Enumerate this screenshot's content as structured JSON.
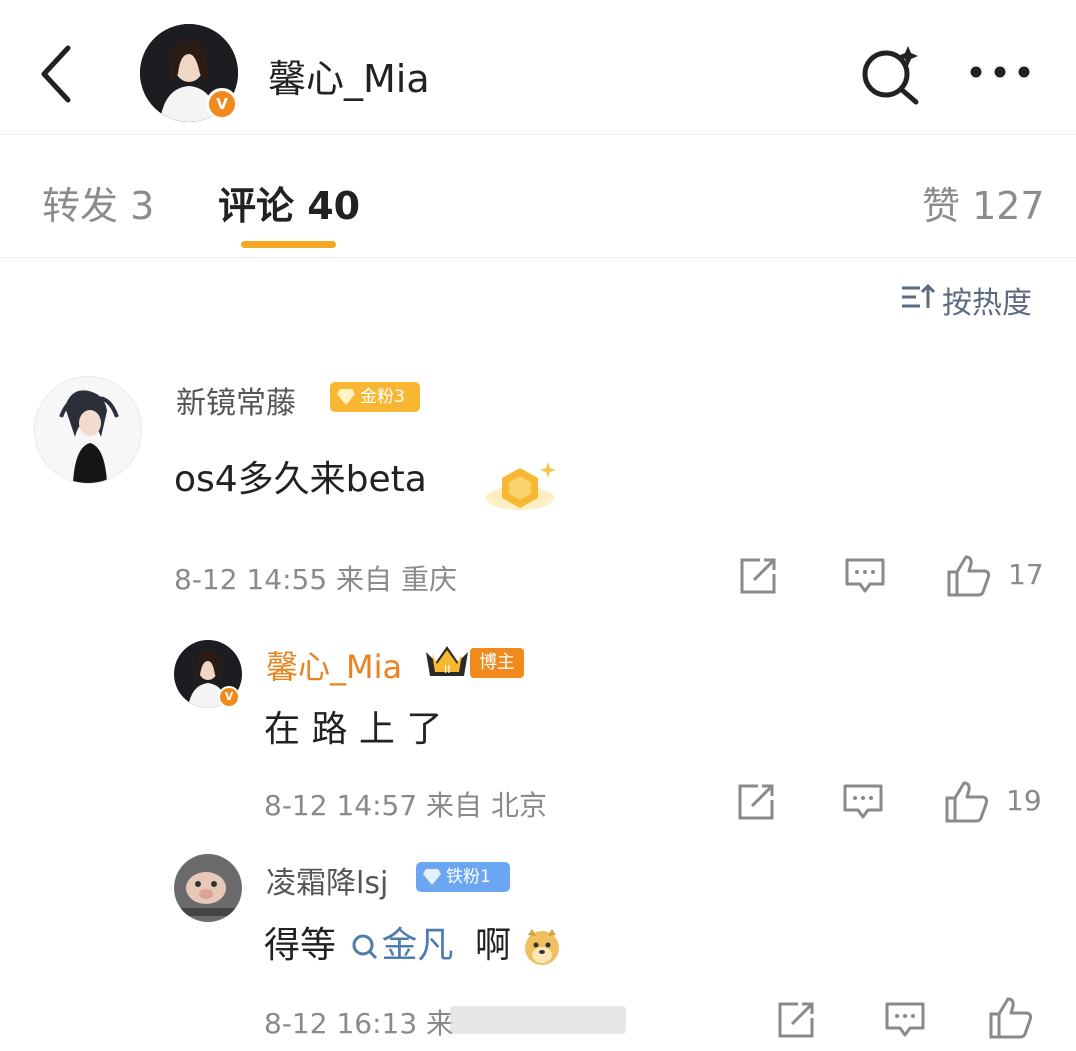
{
  "header": {
    "username": "馨心_Mia",
    "back_icon": "chevron-left-icon",
    "search_icon": "search-sparkle-icon",
    "more_icon": "more-dots-icon"
  },
  "tabs": {
    "repost": "转发 3",
    "comments": "评论 40",
    "likes": "赞 127",
    "active_color": "#f5a623"
  },
  "sort": {
    "label": "按热度",
    "icon": "sort-icon"
  },
  "comments": [
    {
      "username": "新镜常藤",
      "badge": "金粉3",
      "text": "os4多久来beta",
      "meta": "8-12 14:55  来自 重庆",
      "likes": "17"
    },
    {
      "username": "馨心_Mia",
      "badge": "博主",
      "text": "在 路 上 了",
      "meta": "8-12 14:57  来自 北京",
      "likes": "19"
    },
    {
      "username": "凌霜降lsj",
      "badge": "铁粉1",
      "text_before": "得等",
      "link_text": "金凡",
      "text_after": "啊",
      "meta": "8-12 16:13  来"
    }
  ],
  "colors": {
    "orange_name": "#e8831f",
    "link_blue": "#507daf",
    "gold_badge": "#f7b733",
    "blue_badge": "#6aa6f2"
  }
}
